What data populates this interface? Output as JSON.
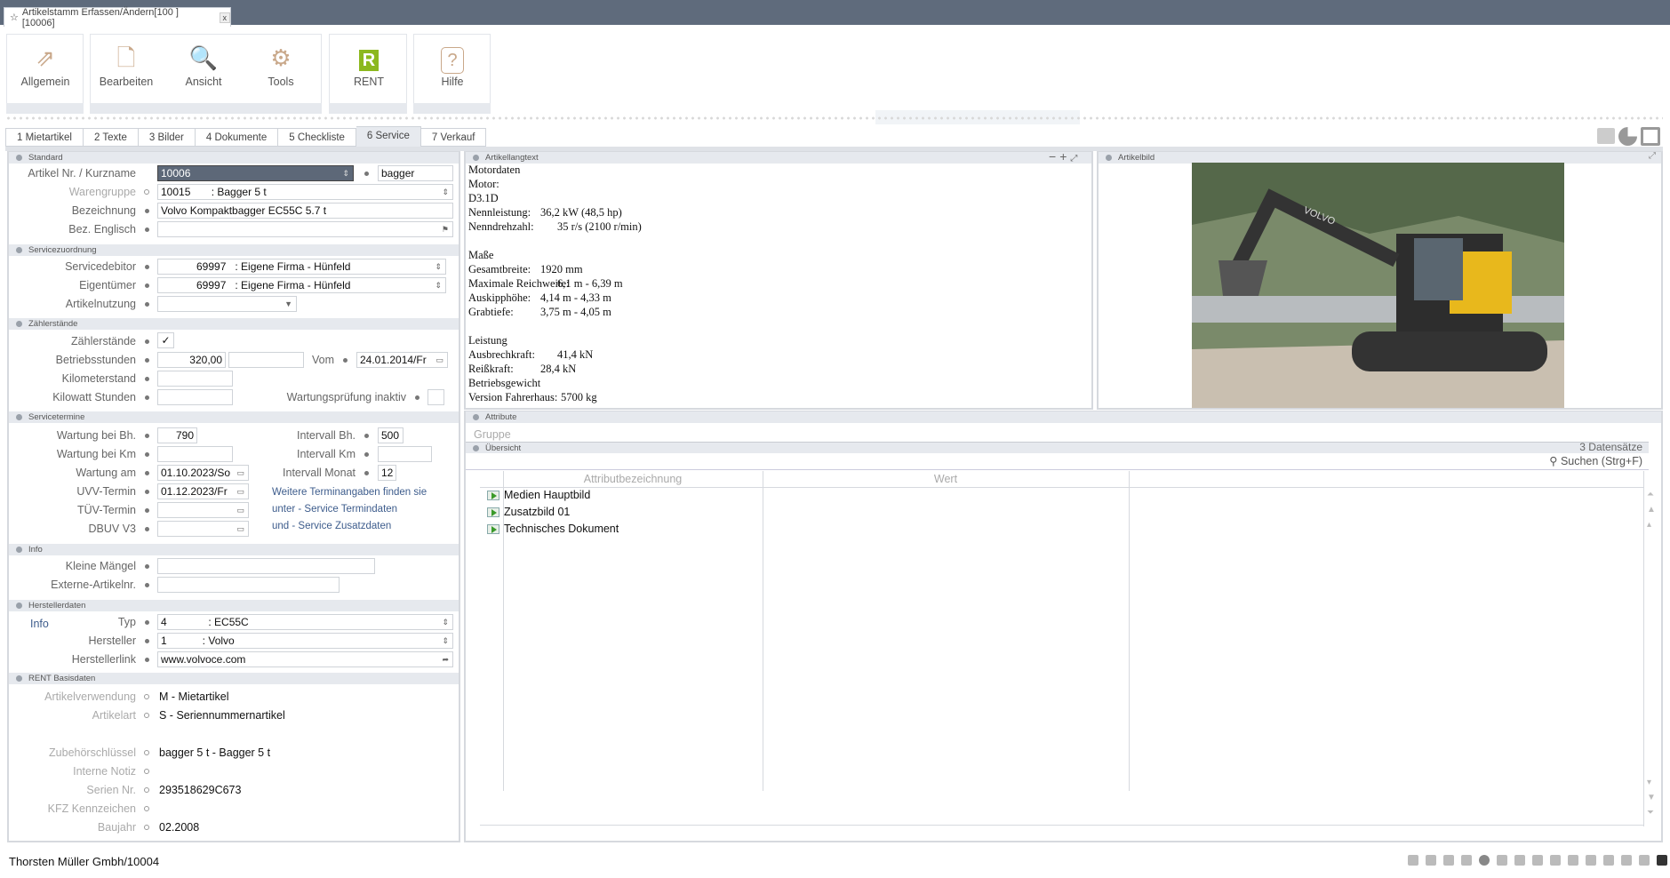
{
  "window": {
    "tab_title": "Artikelstamm Erfassen/Ändern[100 ] [10006]",
    "close": "x"
  },
  "ribbon": {
    "allgemein": "Allgemein",
    "bearbeiten": "Bearbeiten",
    "ansicht": "Ansicht",
    "tools": "Tools",
    "rent": "RENT",
    "rent_logo": "R",
    "hilfe": "Hilfe"
  },
  "tabs": [
    "1 Mietartikel",
    "2 Texte",
    "3 Bilder",
    "4 Dokumente",
    "5 Checkliste",
    "6 Service",
    "7 Verkauf"
  ],
  "standard": {
    "header": "Standard",
    "artikel_label": "Artikel Nr. / Kurzname",
    "artikel_nr": "10006",
    "kurzname": "bagger",
    "warengruppe_label": "Warengruppe",
    "warengruppe": "10015       : Bagger 5 t",
    "bezeichnung_label": "Bezeichnung",
    "bezeichnung": "Volvo Kompaktbagger EC55C 5.7 t",
    "bez_englisch_label": "Bez. Englisch",
    "bez_englisch": ""
  },
  "servicezuordnung": {
    "header": "Servicezuordnung",
    "servicedebitor_label": "Servicedebitor",
    "servicedebitor": "            69997   : Eigene Firma - Hünfeld",
    "eigentuemer_label": "Eigentümer",
    "eigentuemer": "            69997   : Eigene Firma - Hünfeld",
    "artikelnutzung_label": "Artikelnutzung",
    "artikelnutzung": ""
  },
  "zaehlerstaende": {
    "header": "Zählerstände",
    "zaehlerstaende_label": "Zählerstände",
    "zaehlerstaende_checked": true,
    "betriebsstunden_label": "Betriebsstunden",
    "betriebsstunden": "320,00",
    "vom_label": "Vom",
    "vom": "24.01.2014/Fr",
    "kilometerstand_label": "Kilometerstand",
    "kilowatt_label": "Kilowatt Stunden",
    "wartungspruefung_label": "Wartungsprüfung inaktiv"
  },
  "servicetermine": {
    "header": "Servicetermine",
    "wartung_bh_label": "Wartung bei Bh.",
    "wartung_bh": "790",
    "wartung_km_label": "Wartung bei Km",
    "wartung_am_label": "Wartung am",
    "wartung_am": "01.10.2023/So",
    "uvv_label": "UVV-Termin",
    "uvv": "01.12.2023/Fr",
    "tuev_label": "TÜV-Termin",
    "dbuv_label": "DBUV V3",
    "intervall_bh_label": "Intervall Bh.",
    "intervall_bh": "500",
    "intervall_km_label": "Intervall Km",
    "intervall_monat_label": "Intervall Monat",
    "intervall_monat": "12",
    "hint": [
      "Weitere Terminangaben finden sie",
      "unter - Service Termindaten",
      "und - Service Zusatzdaten"
    ]
  },
  "info": {
    "header": "Info",
    "maengel_label": "Kleine Mängel",
    "extern_label": "Externe-Artikelnr."
  },
  "hersteller": {
    "header": "Herstellerdaten",
    "info_link": "Info",
    "typ_label": "Typ",
    "typ": "4              : EC55C",
    "hersteller_label": "Hersteller",
    "hersteller": "1            : Volvo",
    "link_label": "Herstellerlink",
    "link": "www.volvoce.com"
  },
  "rent": {
    "header": "RENT Basisdaten",
    "fields": [
      {
        "label": "Artikelverwendung",
        "value": "M - Mietartikel"
      },
      {
        "label": "Artikelart",
        "value": "S - Seriennummernartikel"
      },
      {
        "label": "Zubehörschlüssel",
        "value": "bagger 5 t - Bagger 5 t"
      },
      {
        "label": "Interne Notiz",
        "value": ""
      },
      {
        "label": "Serien Nr.",
        "value": "293518629C673"
      },
      {
        "label": "KFZ Kennzeichen",
        "value": ""
      },
      {
        "label": "Baujahr",
        "value": "02.2008"
      }
    ]
  },
  "langtext": {
    "header": "Artikellangtext",
    "lines": [
      [
        "Motordaten",
        ""
      ],
      [
        "Motor:",
        ""
      ],
      [
        "D3.1D",
        ""
      ],
      [
        "Nennleistung:",
        "36,2 kW (48,5 hp)"
      ],
      [
        "Nenndrehzahl:",
        "35 r/s (2100 r/min)"
      ],
      [
        "",
        ""
      ],
      [
        "Maße",
        ""
      ],
      [
        "Gesamtbreite:",
        "1920 mm"
      ],
      [
        "Maximale Reichweite:",
        "6,1 m - 6,39 m"
      ],
      [
        "Auskipphöhe:",
        "4,14 m - 4,33 m"
      ],
      [
        "Grabtiefe:",
        "3,75 m - 4,05 m"
      ],
      [
        "",
        ""
      ],
      [
        "Leistung",
        ""
      ],
      [
        "Ausbrechkraft:",
        "41,4 kN"
      ],
      [
        "Reißkraft:",
        "28,4 kN"
      ],
      [
        "Betriebsgewicht",
        ""
      ],
      [
        "Version Fahrerhaus:",
        "5700 kg"
      ]
    ]
  },
  "bild": {
    "header": "Artikelbild",
    "brand": "VOLVO"
  },
  "attribute": {
    "header": "Attribute",
    "gruppe": "Gruppe",
    "uebersicht": "Übersicht",
    "count": "3 Datensätze",
    "search": "Suchen (Strg+F)",
    "col_name": "Attributbezeichnung",
    "col_value": "Wert",
    "rows": [
      "Medien Hauptbild",
      "Zusatzbild 01",
      "Technisches Dokument"
    ]
  },
  "status": {
    "company": "Thorsten Müller Gmbh/10004"
  }
}
